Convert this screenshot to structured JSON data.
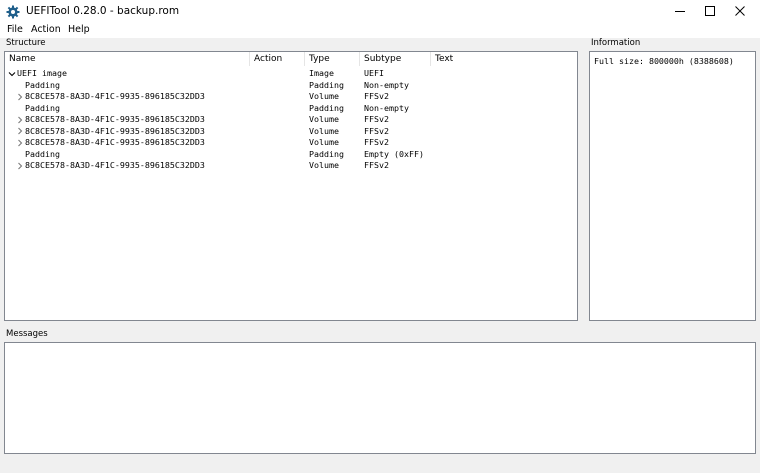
{
  "window": {
    "title": "UEFITool 0.28.0 - backup.rom"
  },
  "menu": {
    "items": [
      "File",
      "Action",
      "Help"
    ]
  },
  "structure": {
    "label": "Structure",
    "columns": [
      "Name",
      "Action",
      "Type",
      "Subtype",
      "Text"
    ],
    "rows": [
      {
        "name": "UEFI image",
        "action": "",
        "type": "Image",
        "subtype": "UEFI",
        "text": "",
        "expander": "expanded",
        "level": 0
      },
      {
        "name": "Padding",
        "action": "",
        "type": "Padding",
        "subtype": "Non-empty",
        "text": "",
        "expander": "none",
        "level": 1
      },
      {
        "name": "8C8CE578-8A3D-4F1C-9935-896185C32DD3",
        "action": "",
        "type": "Volume",
        "subtype": "FFSv2",
        "text": "",
        "expander": "collapsed",
        "level": 1
      },
      {
        "name": "Padding",
        "action": "",
        "type": "Padding",
        "subtype": "Non-empty",
        "text": "",
        "expander": "none",
        "level": 1
      },
      {
        "name": "8C8CE578-8A3D-4F1C-9935-896185C32DD3",
        "action": "",
        "type": "Volume",
        "subtype": "FFSv2",
        "text": "",
        "expander": "collapsed",
        "level": 1
      },
      {
        "name": "8C8CE578-8A3D-4F1C-9935-896185C32DD3",
        "action": "",
        "type": "Volume",
        "subtype": "FFSv2",
        "text": "",
        "expander": "collapsed",
        "level": 1
      },
      {
        "name": "8C8CE578-8A3D-4F1C-9935-896185C32DD3",
        "action": "",
        "type": "Volume",
        "subtype": "FFSv2",
        "text": "",
        "expander": "collapsed",
        "level": 1
      },
      {
        "name": "Padding",
        "action": "",
        "type": "Padding",
        "subtype": "Empty (0xFF)",
        "text": "",
        "expander": "none",
        "level": 1
      },
      {
        "name": "8C8CE578-8A3D-4F1C-9935-896185C32DD3",
        "action": "",
        "type": "Volume",
        "subtype": "FFSv2",
        "text": "",
        "expander": "collapsed",
        "level": 1
      }
    ]
  },
  "information": {
    "label": "Information",
    "text": "Full size: 800000h (8388608)"
  },
  "messages": {
    "label": "Messages"
  },
  "icons": {
    "app": "gear-icon",
    "minimize": "minimize-icon",
    "maximize": "maximize-icon",
    "close": "close-icon",
    "expanded": "chevron-down-icon",
    "collapsed": "chevron-right-icon"
  },
  "colors": {
    "app_icon": "#1f5f8b",
    "panel_border": "#828790",
    "expander": "#7a7a7a"
  }
}
